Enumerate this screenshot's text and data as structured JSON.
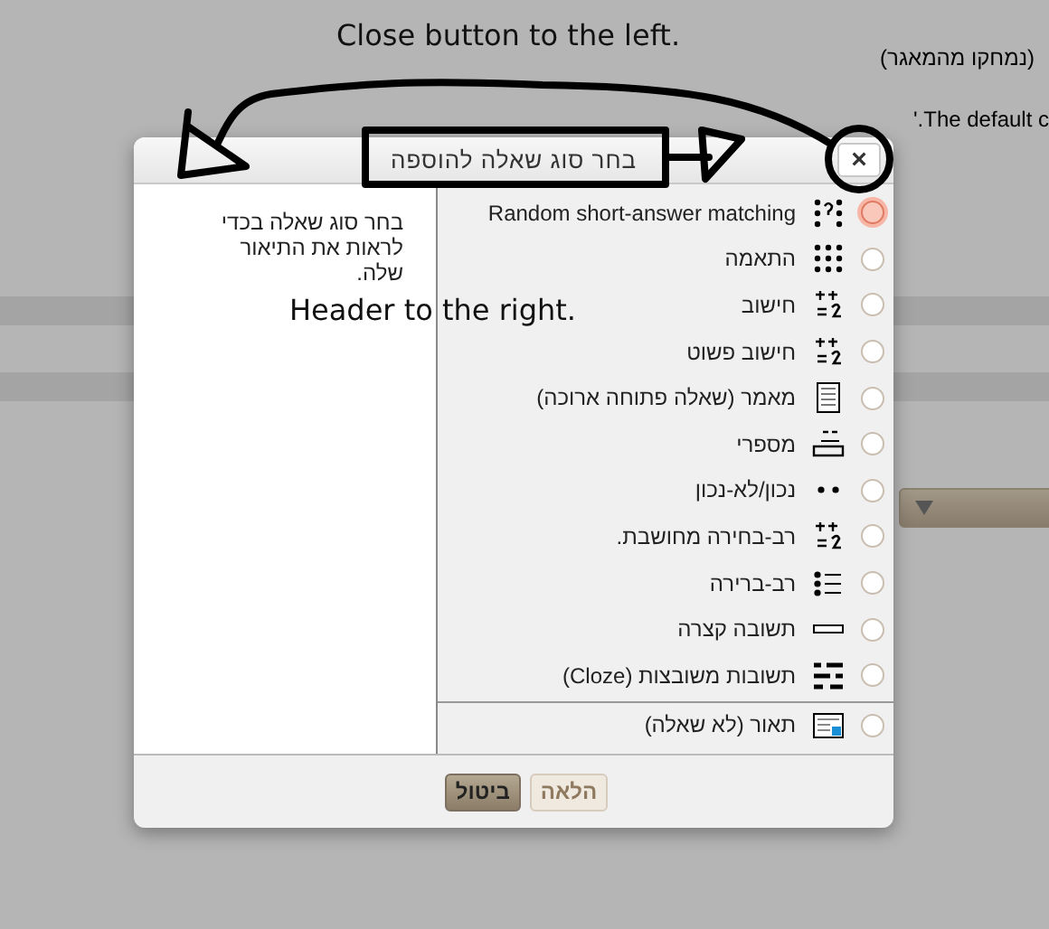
{
  "background_page": {
    "deleted_note": "(נמחקו מהמאגר)",
    "default_note": "'.The default c"
  },
  "annotations": {
    "close_note": "Close button to the left.",
    "header_note": "Header to the right."
  },
  "dialog": {
    "title": "בחר סוג שאלה להוספה",
    "close": "×",
    "description": "בחר סוג שאלה בכדי לראות את התיאור שלה.",
    "options": [
      {
        "label": "Random short-answer matching",
        "selected": true
      },
      {
        "label": "התאמה",
        "selected": false
      },
      {
        "label": "חישוב",
        "selected": false
      },
      {
        "label": "חישוב פשוט",
        "selected": false
      },
      {
        "label": "מאמר (שאלה פתוחה ארוכה)",
        "selected": false
      },
      {
        "label": "מספרי",
        "selected": false
      },
      {
        "label": "נכון/לא-נכון",
        "selected": false
      },
      {
        "label": "רב-בחירה מחושבת.",
        "selected": false
      },
      {
        "label": "רב-ברירה",
        "selected": false
      },
      {
        "label": "תשובה קצרה",
        "selected": false
      },
      {
        "label": "תשובות משובצות (Cloze)",
        "selected": false
      }
    ],
    "other_options": [
      {
        "label": "תאור (לא שאלה)",
        "selected": false
      }
    ],
    "buttons": [
      {
        "label": "הלאה",
        "disabled": true
      },
      {
        "label": "ביטול",
        "disabled": false
      }
    ]
  }
}
